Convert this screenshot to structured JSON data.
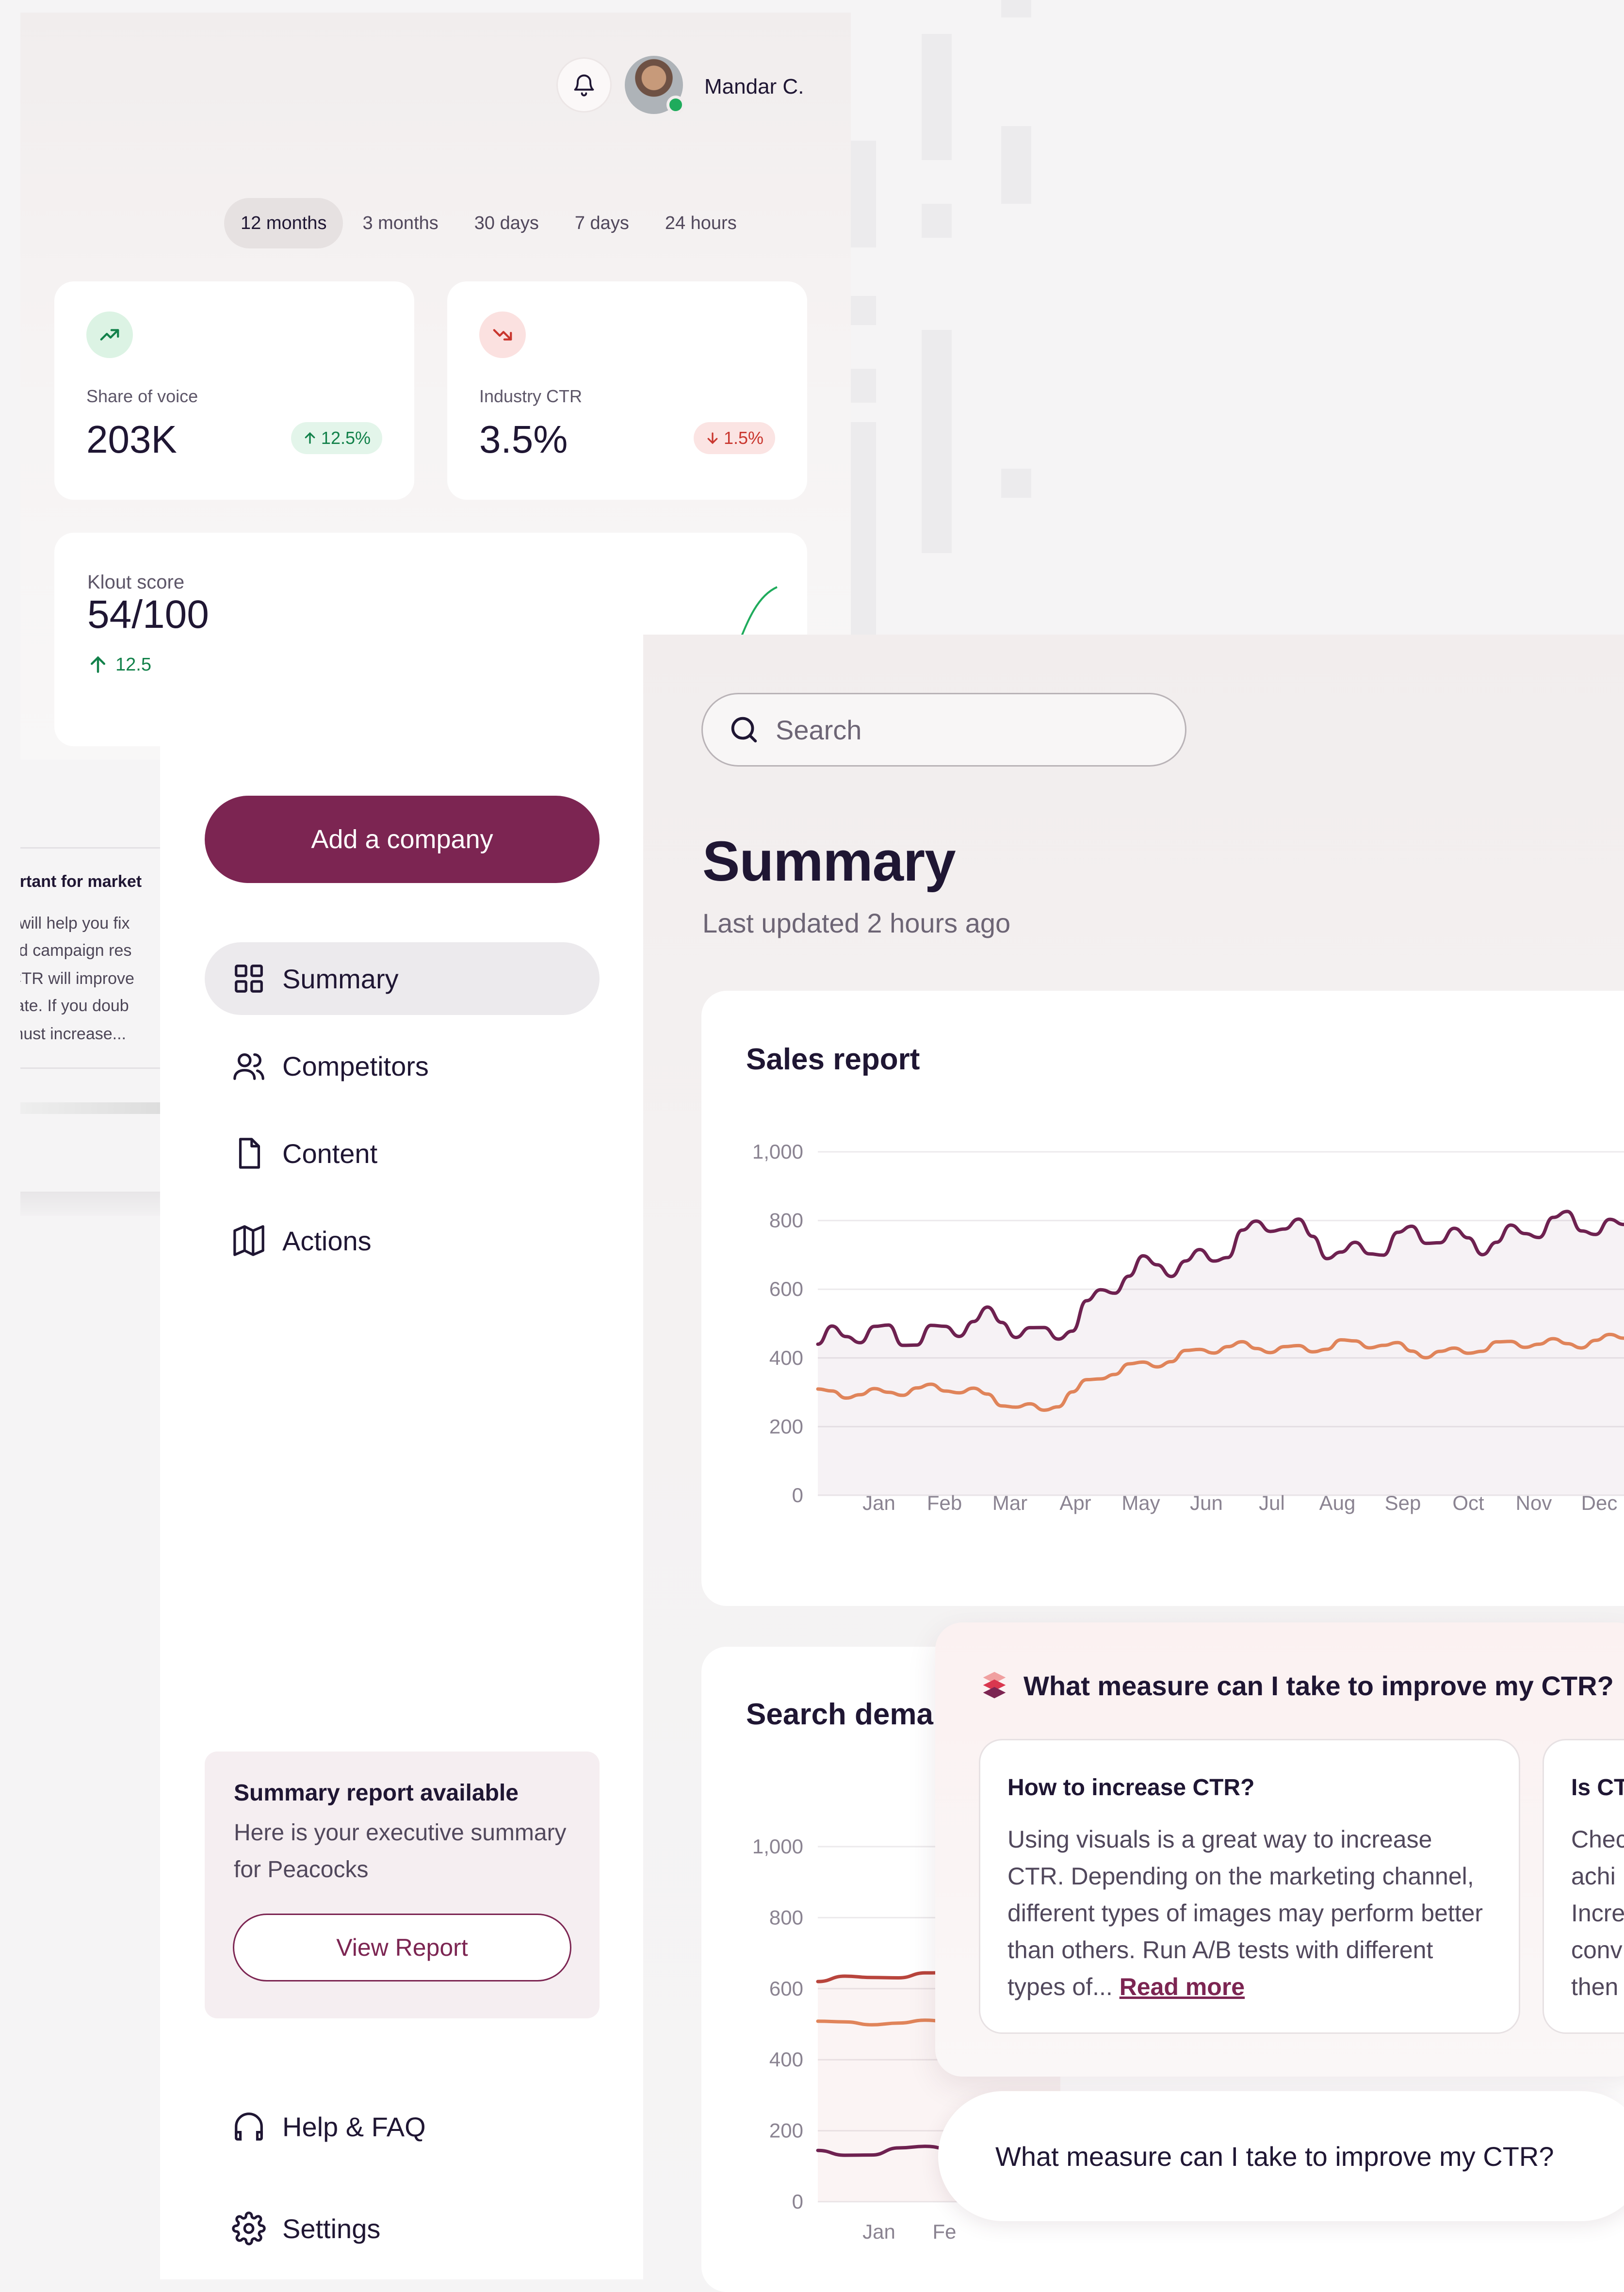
{
  "header": {
    "user_name": "Mandar C."
  },
  "range_tabs": [
    "12 months",
    "3 months",
    "30 days",
    "7 days",
    "24 hours"
  ],
  "stats": [
    {
      "label": "Share of voice",
      "value": "203K",
      "delta": "12.5%",
      "trend": "up"
    },
    {
      "label": "Industry CTR",
      "value": "3.5%",
      "delta": "1.5%",
      "trend": "down"
    }
  ],
  "klout": {
    "label": "Klout score",
    "value": "54/100",
    "delta": "12.5"
  },
  "article_snippet": {
    "title": "ortant for market",
    "lines": [
      "t will help you fix",
      "od campaign res",
      "CTR will improve",
      "rate. If you doub",
      "must increase..."
    ]
  },
  "sidebar": {
    "add_company": "Add a company",
    "nav": [
      "Summary",
      "Competitors",
      "Content",
      "Actions"
    ],
    "report": {
      "title": "Summary report available",
      "desc": "Here is your executive summary for Peacocks",
      "button": "View Report"
    },
    "help": "Help & FAQ",
    "settings": "Settings"
  },
  "main": {
    "search_placeholder": "Search",
    "title": "Summary",
    "subtitle": "Last updated 2 hours ago"
  },
  "colors": {
    "brand": "#7c2552",
    "series_dark": "#6e2150",
    "series_orange": "#e0845a",
    "up": "#12814a",
    "down": "#c9362e"
  },
  "chart_data": [
    {
      "type": "line",
      "title": "Sales report",
      "categories": [
        "Jan",
        "Feb",
        "Mar",
        "Apr",
        "May",
        "Jun",
        "Jul",
        "Aug",
        "Sep",
        "Oct",
        "Nov",
        "Dec"
      ],
      "ylim": [
        0,
        1000
      ],
      "yticks": [
        "0",
        "200",
        "400",
        "600",
        "800",
        "1,000"
      ],
      "series": [
        {
          "values": [
            440,
            470,
            500,
            470,
            620,
            700,
            780,
            720,
            740,
            760,
            780,
            800
          ]
        },
        {
          "values": [
            290,
            310,
            300,
            250,
            370,
            420,
            430,
            440,
            420,
            430,
            450,
            470
          ]
        }
      ]
    },
    {
      "type": "line",
      "title": "Search dema",
      "categories": [
        "Jan",
        "Fe"
      ],
      "ylim": [
        0,
        1000
      ],
      "yticks": [
        "0",
        "200",
        "400",
        "600",
        "800",
        "1,000"
      ],
      "series": [
        {
          "values": [
            620,
            640,
            630
          ]
        },
        {
          "values": [
            500,
            510,
            505
          ]
        },
        {
          "values": [
            140,
            150,
            160
          ]
        }
      ]
    }
  ],
  "ai": {
    "question": "What measure can I take to improve my CTR?",
    "cards": [
      {
        "title": "How to increase CTR?",
        "body": "Using visuals is a great way to increase CTR. Depending on the marketing channel, different types of images may perform better than others. Run A/B tests with different types of...",
        "link": "Read more"
      },
      {
        "title": "Is CT",
        "body": "Chec achi Incre conv then"
      }
    ],
    "input_value": "What measure can I take to improve my CTR?"
  }
}
